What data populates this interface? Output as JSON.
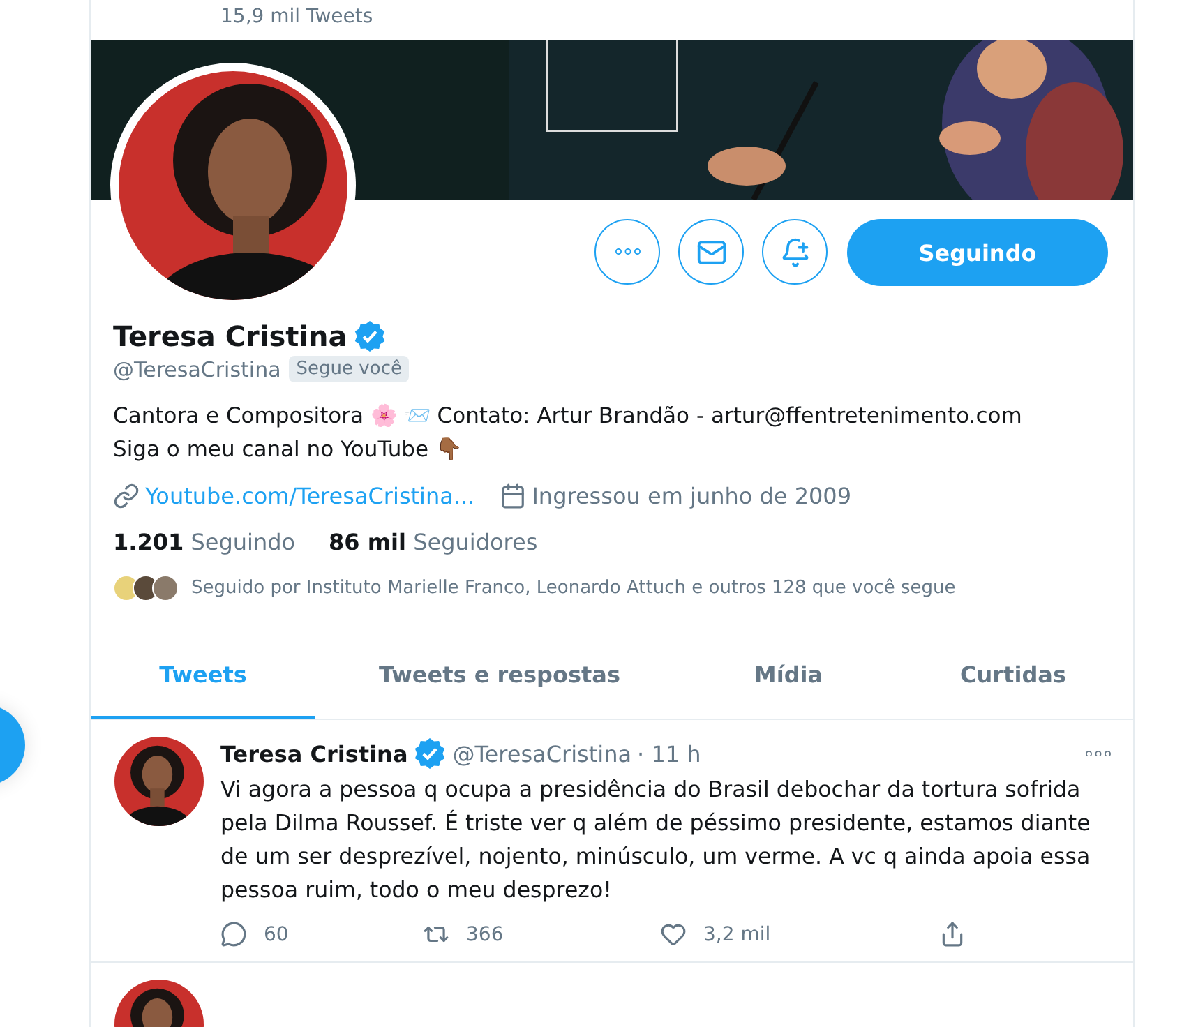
{
  "header": {
    "tweet_count": "15,9 mil Tweets"
  },
  "profile": {
    "banner": {
      "kind": "picture"
    },
    "avatar": {
      "kind": "picture"
    },
    "actions": [
      {
        "kind": "more"
      },
      {
        "kind": "message"
      },
      {
        "kind": "notify"
      }
    ],
    "follow_button": "Seguindo",
    "name": "Teresa Cristina",
    "verified": true,
    "handle": "@TeresaCristina",
    "follows_you": "Segue você",
    "bio": [
      "Cantora e Compositora 🌸 📨 Contato: Artur Brandão - artur@ffentretenimento.com",
      "Siga o meu canal no YouTube 👇🏾"
    ],
    "link": "Youtube.com/TeresaCristina...",
    "joined": "Ingressou em junho de 2009",
    "stats": [
      {
        "count": "1.201",
        "label": "Seguindo"
      },
      {
        "count": "86 mil",
        "label": "Seguidores"
      }
    ],
    "followed_by": {
      "avatars": [
        {
          "color": "#e8d27a"
        },
        {
          "color": "#5a4a3a"
        },
        {
          "color": "#8a7a6a"
        }
      ],
      "text": "Seguido por Instituto Marielle Franco, Leonardo Attuch e outros 128 que você segue"
    }
  },
  "tabs": [
    {
      "label": "Tweets",
      "selected": true
    },
    {
      "label": "Tweets e respostas",
      "selected": false
    },
    {
      "label": "Mídia",
      "selected": false
    },
    {
      "label": "Curtidas",
      "selected": false
    }
  ],
  "tweets": [
    {
      "author": "Teresa Cristina",
      "verified": true,
      "handle": "@TeresaCristina",
      "time": "· 11 h",
      "text": "Vi agora a pessoa q ocupa a presidência do Brasil debochar da tortura sofrida pela Dilma Roussef. É triste ver q além de péssimo presidente, estamos diante de um ser desprezível, nojento, minúsculo, um verme. A vc q ainda apoia essa pessoa ruim, todo o meu desprezo!",
      "actions": [
        {
          "kind": "reply",
          "count": "60"
        },
        {
          "kind": "retweet",
          "count": "366"
        },
        {
          "kind": "like",
          "count": "3,2 mil"
        },
        {
          "kind": "share"
        }
      ]
    },
    {
      "kind": "partial"
    }
  ]
}
